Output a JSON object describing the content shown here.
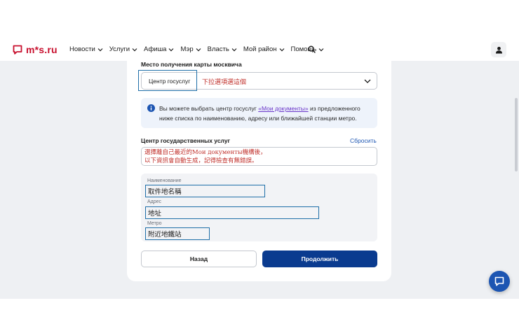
{
  "header": {
    "logo_text": "m*s.ru",
    "nav": [
      {
        "label": "Новости"
      },
      {
        "label": "Услуги"
      },
      {
        "label": "Афиша"
      },
      {
        "label": "Мэр"
      },
      {
        "label": "Власть"
      },
      {
        "label": "Мой район"
      },
      {
        "label": "Помощь"
      }
    ]
  },
  "form": {
    "place_label": "Место получения карты москвича",
    "place_value": "Центр госуслуг",
    "info_prefix": "Вы можете выбрать центр госуслуг ",
    "info_link": "«Мои документы»",
    "info_suffix": " из предложенного ниже списка по наименованию, адресу или ближайшей станции метро.",
    "center_label": "Центр государственных услуг",
    "reset_label": "Сбросить",
    "name_label": "Наименование",
    "address_label": "Адрес",
    "metro_label": "Метро",
    "back_label": "Назад",
    "continue_label": "Продолжить"
  },
  "annotations": {
    "select_note": "下拉選項選這個",
    "center_note": "選擇離自己最近的Мои документы機構後，\n以下資訊會自動生成，記得檢查有無錯誤。",
    "name_value": "取件地名稱",
    "address_value": "地址",
    "metro_value": "附近地鐵站"
  },
  "colors": {
    "accent": "#0a3b8f",
    "link": "#1c55b2",
    "annotation": "#c0302b",
    "annotation_box": "#1f6fa8"
  }
}
